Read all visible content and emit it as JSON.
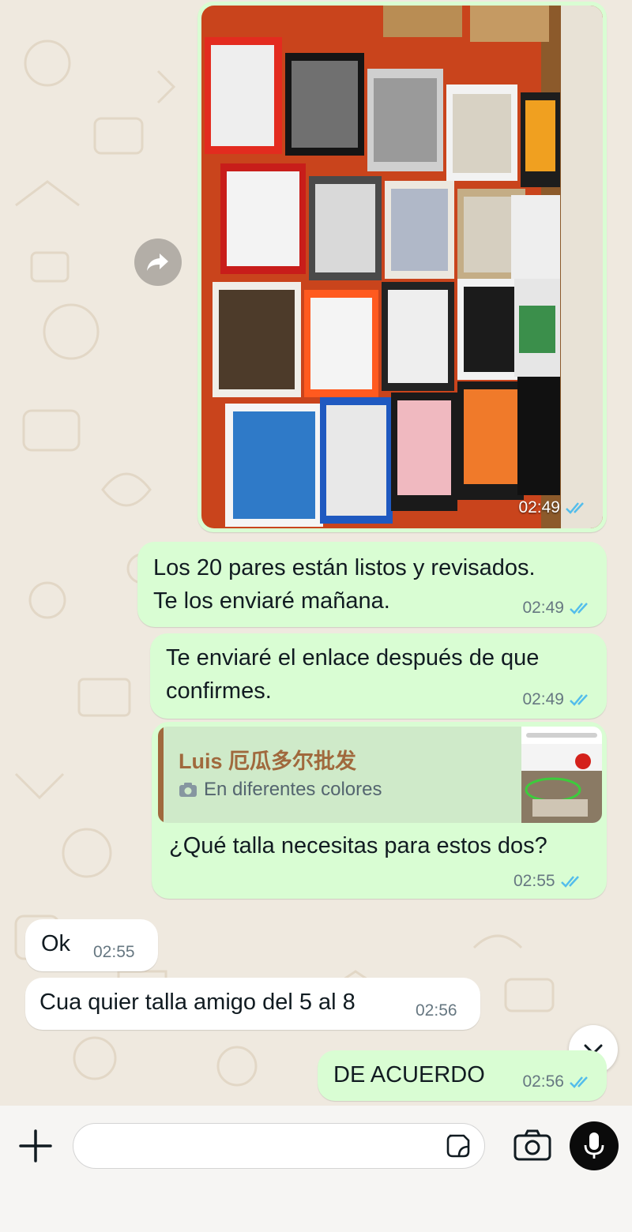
{
  "chat": {
    "messages": [
      {
        "type": "image",
        "direction": "outgoing",
        "time": "02:49",
        "status": "read"
      },
      {
        "type": "text",
        "direction": "outgoing",
        "text": "Los 20 pares están listos y revisados.\nTe los enviaré mañana.",
        "time": "02:49",
        "status": "read"
      },
      {
        "type": "text",
        "direction": "outgoing",
        "text": "Te enviaré el enlace después de que\nconfirmes.",
        "time": "02:49",
        "status": "read"
      },
      {
        "type": "reply",
        "direction": "outgoing",
        "quote": {
          "author": "Luis 厄瓜多尔批发",
          "icon": "camera-icon",
          "text": "En diferentes colores"
        },
        "text": "¿Qué talla necesitas para estos dos?",
        "time": "02:55",
        "status": "read"
      },
      {
        "type": "text",
        "direction": "incoming",
        "text": "Ok",
        "time": "02:55"
      },
      {
        "type": "text",
        "direction": "incoming",
        "text": "Cua quier talla amigo del 5 al 8",
        "time": "02:56"
      },
      {
        "type": "text",
        "direction": "outgoing",
        "text": "DE ACUERDO",
        "time": "02:56",
        "status": "read"
      }
    ]
  },
  "composer": {
    "input_value": "",
    "icons": [
      "plus-icon",
      "sticker-icon",
      "camera-icon",
      "microphone-icon"
    ]
  },
  "colors": {
    "outgoing_bubble": "#d9fdd3",
    "incoming_bubble": "#ffffff",
    "read_ticks": "#53bdeb",
    "quote_author": "#a0693d",
    "wallpaper": "#efe9df"
  }
}
